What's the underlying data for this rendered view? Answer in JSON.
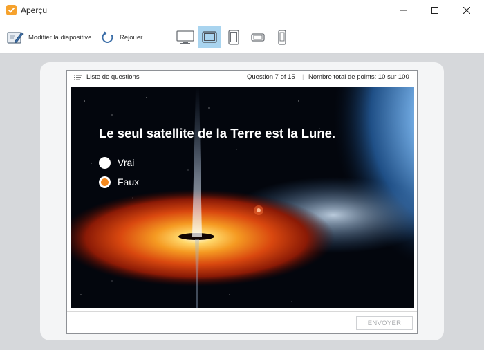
{
  "window": {
    "title": "Aperçu",
    "icon": "check-icon",
    "accent": "#f6a22d"
  },
  "toolbar": {
    "edit_label": "Modifier la diapositive",
    "replay_label": "Rejouer",
    "devices": [
      "desktop-icon",
      "tablet-landscape-icon",
      "tablet-portrait-icon",
      "phone-landscape-icon",
      "phone-portrait-icon"
    ],
    "active_device": "tablet-landscape-icon",
    "active_color": "#a9d4ef"
  },
  "slide": {
    "question_list_label": "Liste de questions",
    "question_counter": "Question 7 of 15",
    "points": "Nombre total de points: 10 sur 100",
    "question": "Le seul satellite de la Terre est la Lune.",
    "options": [
      {
        "label": "Vrai",
        "selected": false
      },
      {
        "label": "Faux",
        "selected": true
      }
    ],
    "selected_color": "#f4891f",
    "submit_label": "ENVOYER"
  }
}
